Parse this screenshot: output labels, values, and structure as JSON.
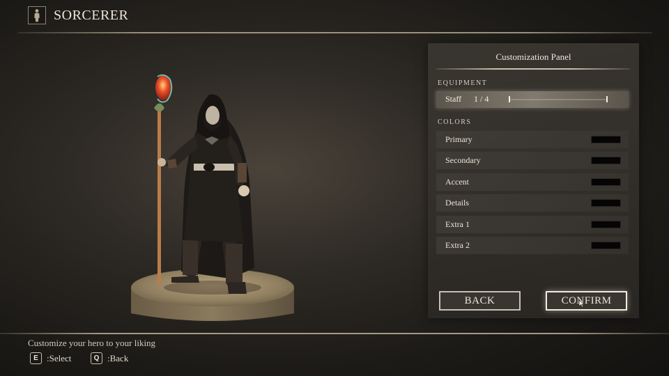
{
  "header": {
    "title": "SORCERER",
    "icon": "character-silhouette-icon"
  },
  "panel": {
    "title": "Customization Panel",
    "equipment": {
      "label": "EQUIPMENT",
      "item": {
        "name": "Staff",
        "count": "1 / 4"
      }
    },
    "colors": {
      "label": "COLORS",
      "items": [
        {
          "name": "Primary",
          "swatch": "#050505"
        },
        {
          "name": "Secondary",
          "swatch": "#050505"
        },
        {
          "name": "Accent",
          "swatch": "#050505"
        },
        {
          "name": "Details",
          "swatch": "#050505"
        },
        {
          "name": "Extra 1",
          "swatch": "#050505"
        },
        {
          "name": "Extra 2",
          "swatch": "#050505"
        }
      ]
    },
    "buttons": {
      "back": "BACK",
      "confirm": "CONFIRM"
    }
  },
  "footer": {
    "hint": "Customize your hero to your liking",
    "keys": [
      {
        "key": "E",
        "label": ":Select"
      },
      {
        "key": "Q",
        "label": ":Back"
      }
    ]
  },
  "colors": {
    "accent_line": "#9c927f",
    "panel_bg": "#3a3631",
    "text": "#e8e2d6"
  }
}
